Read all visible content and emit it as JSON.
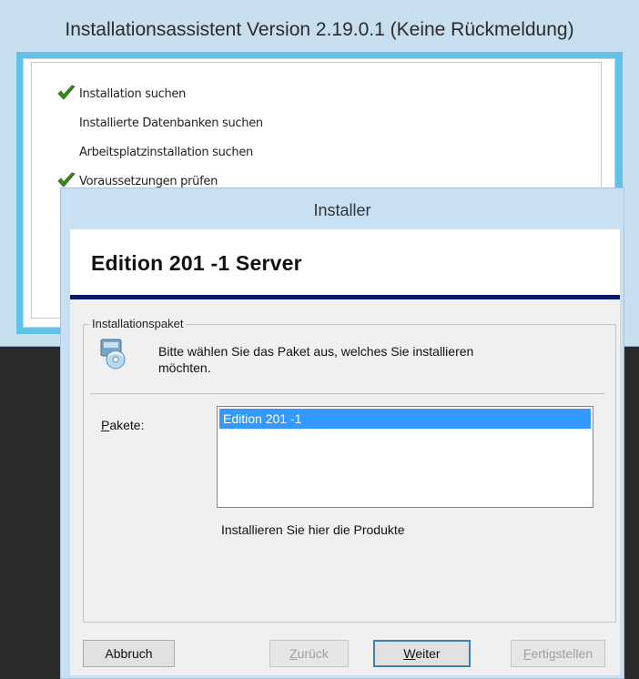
{
  "background_window": {
    "title": "Installationsassistent  Version 2.19.0.1 (Keine Rückmeldung)",
    "steps": [
      {
        "label": "Installation suchen",
        "done": true
      },
      {
        "label": "Installierte Datenbanken suchen",
        "done": false
      },
      {
        "label": "Arbeitsplatzinstallation suchen",
        "done": false
      },
      {
        "label": "Voraussetzungen prüfen",
        "done": true
      }
    ]
  },
  "dialog": {
    "title": "Installer",
    "heading": "Edition 201  -1 Server",
    "group_label": "Installationspaket",
    "intro_line1": "Bitte wählen Sie das Paket aus, welches Sie installieren",
    "intro_line2": "möchten.",
    "pakete_label_accel": "P",
    "pakete_label_rest": "akete:",
    "packages": [
      "Edition 201  -1"
    ],
    "hint": "Installieren Sie hier die Produkte",
    "buttons": {
      "cancel": "Abbruch",
      "back_accel": "Z",
      "back_rest": "urück",
      "next_accel": "W",
      "next_rest": "eiter",
      "finish_accel": "F",
      "finish_rest": "ertigstellen"
    }
  },
  "colors": {
    "accent_frame": "#61c2e9",
    "header_rule": "#08186e",
    "selection": "#3399ff",
    "check": "#3a8a1a"
  }
}
